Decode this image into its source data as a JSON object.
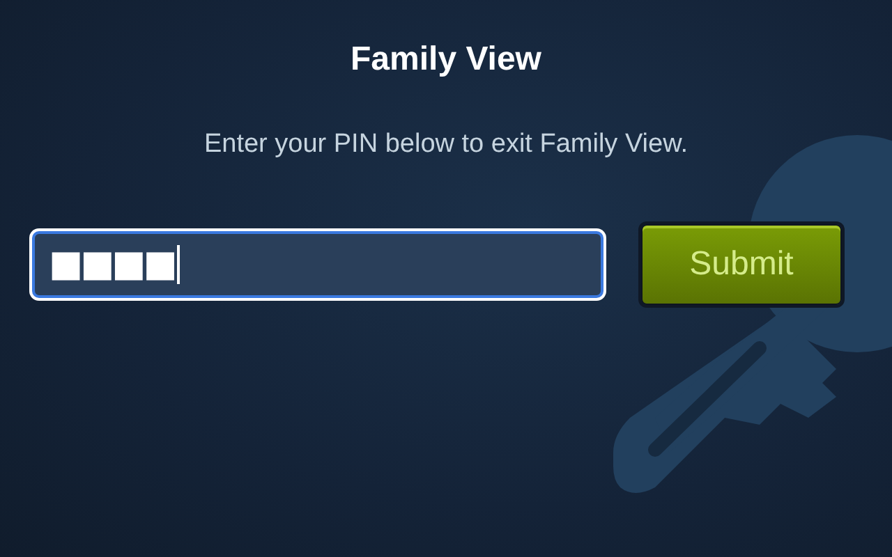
{
  "title": "Family View",
  "message": "Enter your PIN below to exit Family View.",
  "pin_field": {
    "value": "■■■■",
    "focused": true
  },
  "buttons": [
    {
      "label": "Submit"
    }
  ]
}
